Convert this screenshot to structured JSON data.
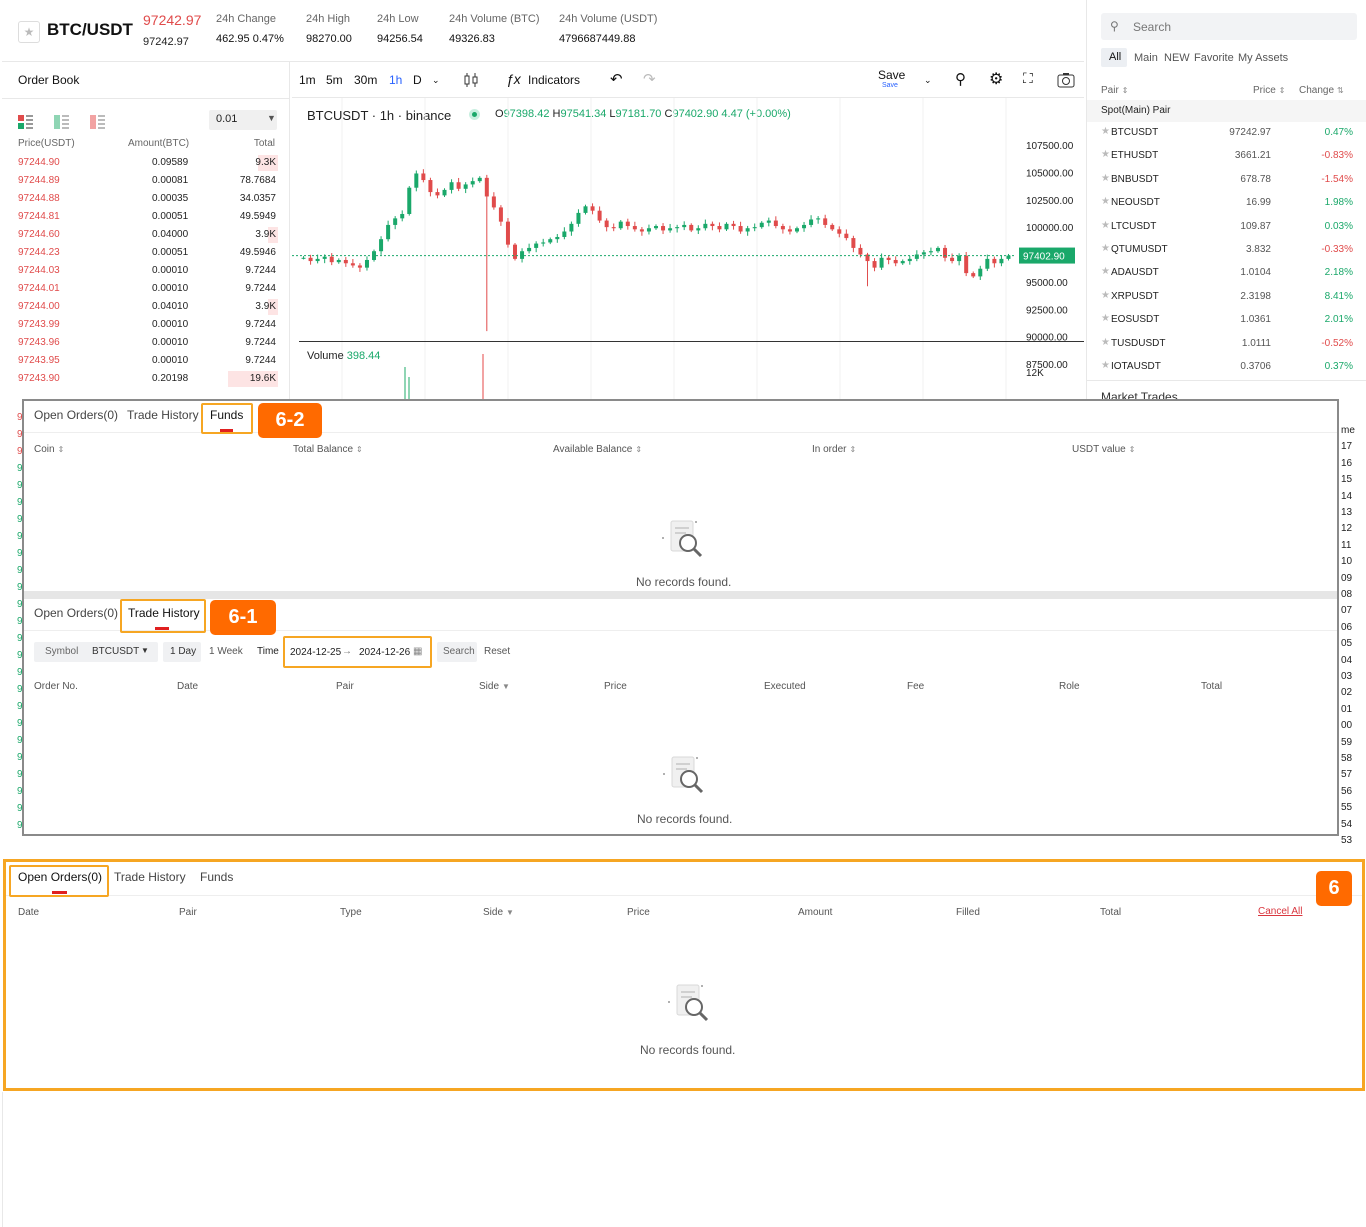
{
  "header": {
    "pair": "BTC/USDT",
    "last_price": "97242.97",
    "last_price_sub": "97242.97",
    "stats": [
      {
        "label": "24h Change",
        "value": "462.95 0.47%"
      },
      {
        "label": "24h High",
        "value": "98270.00"
      },
      {
        "label": "24h Low",
        "value": "94256.54"
      },
      {
        "label": "24h Volume (BTC)",
        "value": "49326.83"
      },
      {
        "label": "24h Volume (USDT)",
        "value": "4796687449.88"
      }
    ]
  },
  "orderbook": {
    "title": "Order Book",
    "step": "0.01",
    "headers": {
      "price": "Price(USDT)",
      "amount": "Amount(BTC)",
      "total": "Total"
    },
    "asks": [
      {
        "price": "97244.90",
        "amount": "0.09589",
        "total": "9.3K",
        "depth": 0.2
      },
      {
        "price": "97244.89",
        "amount": "0.00081",
        "total": "78.7684",
        "depth": 0
      },
      {
        "price": "97244.88",
        "amount": "0.00035",
        "total": "34.0357",
        "depth": 0
      },
      {
        "price": "97244.81",
        "amount": "0.00051",
        "total": "49.5949",
        "depth": 0
      },
      {
        "price": "97244.60",
        "amount": "0.04000",
        "total": "3.9K",
        "depth": 0.1
      },
      {
        "price": "97244.23",
        "amount": "0.00051",
        "total": "49.5946",
        "depth": 0
      },
      {
        "price": "97244.03",
        "amount": "0.00010",
        "total": "9.7244",
        "depth": 0
      },
      {
        "price": "97244.01",
        "amount": "0.00010",
        "total": "9.7244",
        "depth": 0
      },
      {
        "price": "97244.00",
        "amount": "0.04010",
        "total": "3.9K",
        "depth": 0.1
      },
      {
        "price": "97243.99",
        "amount": "0.00010",
        "total": "9.7244",
        "depth": 0
      },
      {
        "price": "97243.96",
        "amount": "0.00010",
        "total": "9.7244",
        "depth": 0
      },
      {
        "price": "97243.95",
        "amount": "0.00010",
        "total": "9.7244",
        "depth": 0
      },
      {
        "price": "97243.90",
        "amount": "0.20198",
        "total": "19.6K",
        "depth": 0.5
      }
    ]
  },
  "chart": {
    "intervals": [
      "1m",
      "5m",
      "30m",
      "1h",
      "D"
    ],
    "active_interval": "1h",
    "indicators_label": "Indicators",
    "save_label": "Save",
    "save_sub": "Save",
    "symbol_line": "BTCUSDT · 1h · binance",
    "ohlc": {
      "o": "97398.42",
      "h": "97541.34",
      "l": "97181.70",
      "c": "97402.90",
      "chg": "4.47 (+0.00%)"
    },
    "y_ticks": [
      "107500.00",
      "105000.00",
      "102500.00",
      "100000.00",
      "95000.00",
      "92500.00",
      "90000.00",
      "87500.00"
    ],
    "current_price": "97402.90",
    "volume_label": "Volume",
    "volume_value": "398.44",
    "volume_tick": "12K"
  },
  "chart_data": {
    "type": "candlestick",
    "ylim": [
      87500,
      107500
    ],
    "current": 97402.9,
    "closes": [
      97200,
      96900,
      97100,
      97300,
      96800,
      97000,
      96700,
      96500,
      96300,
      97000,
      97800,
      98900,
      100200,
      100800,
      101200,
      103600,
      104900,
      104300,
      103200,
      102900,
      103400,
      104100,
      103500,
      103900,
      104200,
      104500,
      102800,
      101800,
      100500,
      98400,
      97100,
      97800,
      98100,
      98500,
      98600,
      98900,
      99100,
      99600,
      100300,
      101300,
      101900,
      101500,
      100600,
      100000,
      99900,
      100500,
      100100,
      99800,
      99600,
      99900,
      100100,
      99700,
      99900,
      100000,
      100200,
      99700,
      99900,
      100300,
      100100,
      99800,
      100300,
      100100,
      99600,
      99900,
      100000,
      100400,
      100600,
      100100,
      99800,
      99600,
      99900,
      100200,
      100700,
      100800,
      100200,
      99800,
      99400,
      99000,
      98100,
      97500,
      96900,
      96300,
      97200,
      97000,
      96700,
      96900,
      97100,
      97500,
      97700,
      97800,
      98100,
      97200,
      96900,
      97400,
      95800,
      95500,
      96200,
      97100,
      96700,
      97100,
      97400
    ]
  },
  "markets": {
    "search_placeholder": "Search",
    "tabs": [
      "All",
      "Main",
      "NEW",
      "Favorite",
      "My Assets"
    ],
    "headers": {
      "pair": "Pair",
      "price": "Price",
      "change": "Change"
    },
    "group": "Spot(Main) Pair",
    "pairs": [
      {
        "name": "BTCUSDT",
        "price": "97242.97",
        "change": "0.47%",
        "up": true
      },
      {
        "name": "ETHUSDT",
        "price": "3661.21",
        "change": "-0.83%",
        "up": false
      },
      {
        "name": "BNBUSDT",
        "price": "678.78",
        "change": "-1.54%",
        "up": false
      },
      {
        "name": "NEOUSDT",
        "price": "16.99",
        "change": "1.98%",
        "up": true
      },
      {
        "name": "LTCUSDT",
        "price": "109.87",
        "change": "0.03%",
        "up": true
      },
      {
        "name": "QTUMUSDT",
        "price": "3.832",
        "change": "-0.33%",
        "up": false
      },
      {
        "name": "ADAUSDT",
        "price": "1.0104",
        "change": "2.18%",
        "up": true
      },
      {
        "name": "XRPUSDT",
        "price": "2.3198",
        "change": "8.41%",
        "up": true
      },
      {
        "name": "EOSUSDT",
        "price": "1.0361",
        "change": "2.01%",
        "up": true
      },
      {
        "name": "TUSDUSDT",
        "price": "1.0111",
        "change": "-0.52%",
        "up": false
      },
      {
        "name": "IOTAUSDT",
        "price": "0.3706",
        "change": "0.37%",
        "up": true
      }
    ],
    "market_trades_label": "Market Trades"
  },
  "bg": {
    "left_prices": [
      "9",
      "9",
      "9",
      "9",
      "9",
      "9",
      "9",
      "9",
      "9",
      "9",
      "9",
      "9",
      "9",
      "9",
      "9",
      "9",
      "9",
      "9",
      "9",
      "9",
      "9",
      "9",
      "9",
      "9",
      "9"
    ],
    "right_times": [
      "me",
      "17",
      "16",
      "15",
      "14",
      "13",
      "12",
      "11",
      "10",
      "09",
      "08",
      "07",
      "06",
      "05",
      "04",
      "03",
      "02",
      "01",
      "00",
      "59",
      "58",
      "57",
      "56",
      "55",
      "54",
      "53"
    ]
  },
  "funds_panel": {
    "tabs": [
      "Open Orders(0)",
      "Trade History",
      "Funds"
    ],
    "active": "Funds",
    "badge": "6-2",
    "columns": [
      "Coin",
      "Total Balance",
      "Available Balance",
      "In order",
      "USDT value"
    ],
    "empty": "No records found."
  },
  "trade_panel": {
    "tabs": [
      "Open Orders(0)",
      "Trade History"
    ],
    "active": "Trade History",
    "badge": "6-1",
    "symbol_label": "Symbol",
    "symbol_value": "BTCUSDT",
    "day_label": "1 Day",
    "week_label": "1 Week",
    "time_label": "Time",
    "date_from": "2024-12-25",
    "date_to": "2024-12-26",
    "search_label": "Search",
    "reset_label": "Reset",
    "columns": [
      "Order No.",
      "Date",
      "Pair",
      "Side",
      "Price",
      "Executed",
      "Fee",
      "Role",
      "Total"
    ],
    "empty": "No records found."
  },
  "orders_panel": {
    "tabs": [
      "Open Orders(0)",
      "Trade History",
      "Funds"
    ],
    "active": "Open Orders(0)",
    "badge": "6",
    "columns": [
      "Date",
      "Pair",
      "Type",
      "Side",
      "Price",
      "Amount",
      "Filled",
      "Total"
    ],
    "cancel_all": "Cancel All",
    "empty": "No records found."
  },
  "colors": {
    "up": "#1aa86a",
    "down": "#e04b4b",
    "highlight": "#f6a623",
    "badge": "#ff6a00"
  }
}
